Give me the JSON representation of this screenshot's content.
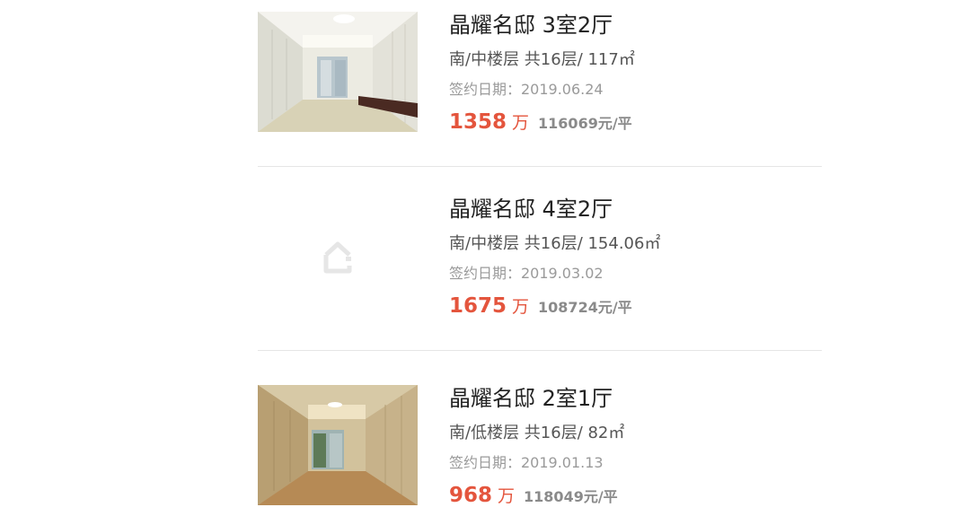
{
  "listings": [
    {
      "title": "晶耀名邸 3室2厅",
      "meta": "南/中楼层 共16层/ 117㎡",
      "signed_date": "签约日期：2019.06.24",
      "total_price": "1358",
      "price_unit": "万",
      "unit_price": "116069元/平",
      "thumbnail": "living-room-photo"
    },
    {
      "title": "晶耀名邸 4室2厅",
      "meta": "南/中楼层 共16层/ 154.06㎡",
      "signed_date": "签约日期：2019.03.02",
      "total_price": "1675",
      "price_unit": "万",
      "unit_price": "108724元/平",
      "thumbnail": "house-placeholder-icon"
    },
    {
      "title": "晶耀名邸 2室1厅",
      "meta": "南/低楼层 共16层/ 82㎡",
      "signed_date": "签约日期：2019.01.13",
      "total_price": "968",
      "price_unit": "万",
      "unit_price": "118049元/平",
      "thumbnail": "living-room-photo"
    }
  ],
  "colors": {
    "price": "#e4553d",
    "title": "#222222",
    "divider": "#e5e5e5"
  }
}
